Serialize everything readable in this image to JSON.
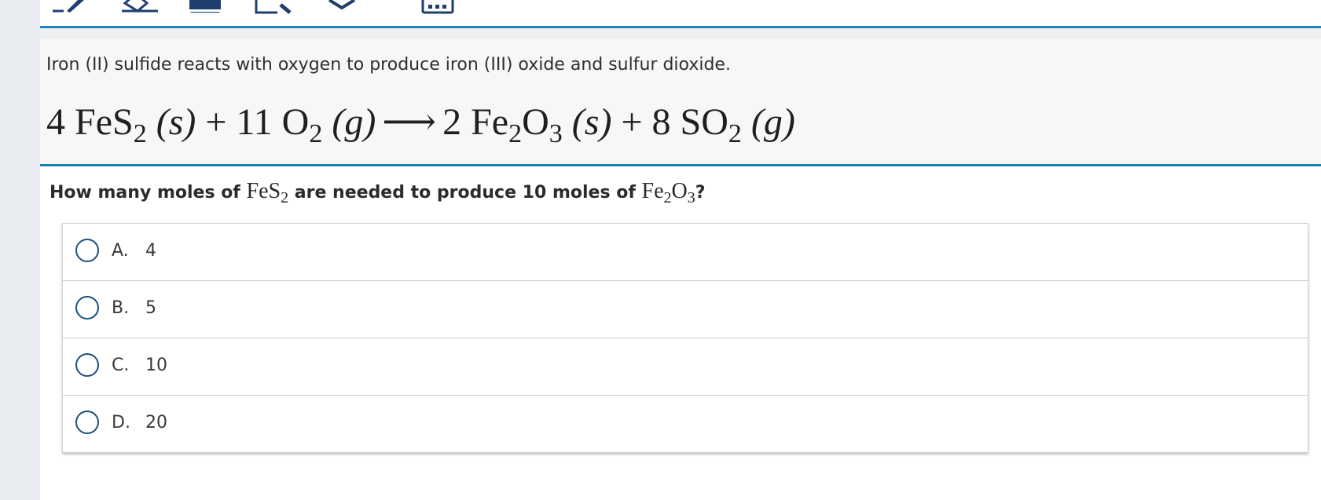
{
  "toolbar": {
    "icons": [
      "pen-icon",
      "eraser-icon",
      "notepad-icon",
      "ruler-icon",
      "crossout-icon",
      "calculator-icon"
    ]
  },
  "stimulus": {
    "text": "Iron (II) sulfide reacts with oxygen to produce iron (III) oxide and sulfur dioxide.",
    "equation": {
      "coef1": "4",
      "r1_a": "FeS",
      "r1_sub": "2",
      "r1_state": "(s)",
      "plus1": "+",
      "coef2": "11",
      "r2_a": "O",
      "r2_sub": "2",
      "r2_state": "(g)",
      "arrow": "⟶",
      "coef3": "2",
      "p1_a": "Fe",
      "p1_sub1": "2",
      "p1_b": "O",
      "p1_sub2": "3",
      "p1_state": "(s)",
      "plus2": "+",
      "coef4": "8",
      "p2_a": "SO",
      "p2_sub": "2",
      "p2_state": "(g)"
    }
  },
  "question": {
    "part1": "How many moles of ",
    "chem1_a": "FeS",
    "chem1_sub": "2",
    "part2": " are needed to produce 10 moles of ",
    "chem2_a": "Fe",
    "chem2_sub1": "2",
    "chem2_b": "O",
    "chem2_sub2": "3",
    "part3": "?"
  },
  "choices": [
    {
      "letter": "A.",
      "value": "4"
    },
    {
      "letter": "B.",
      "value": "5"
    },
    {
      "letter": "C.",
      "value": "10"
    },
    {
      "letter": "D.",
      "value": "20"
    }
  ]
}
